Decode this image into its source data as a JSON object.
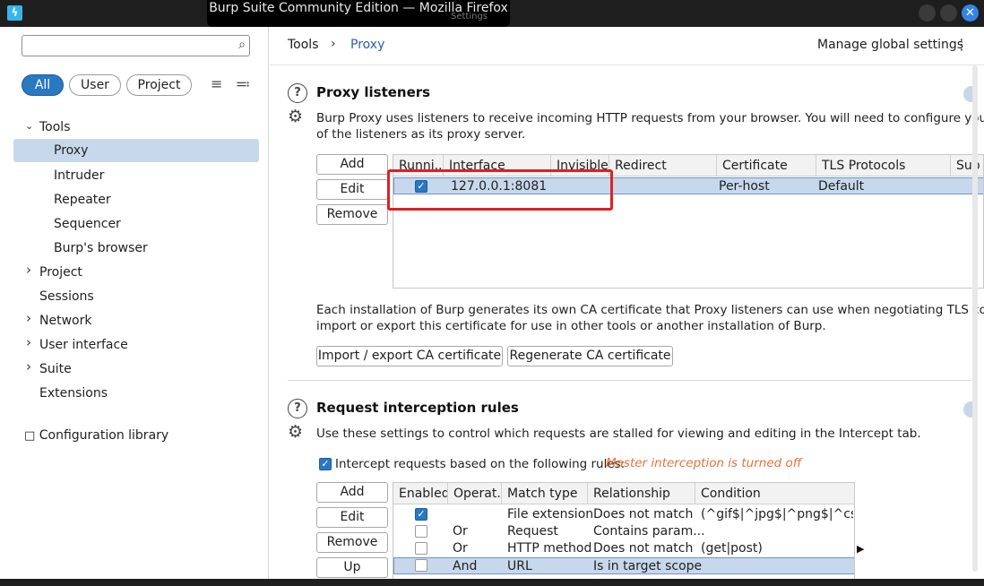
{
  "window": {
    "title": "Burp Suite Community Edition — Mozilla Firefox",
    "ghost_title": "Settings",
    "logo_glyph": "ϟ",
    "close_glyph": "✕"
  },
  "sidebar": {
    "search_placeholder": "",
    "search_icon_glyph": "⌕",
    "filters": [
      "All",
      "User",
      "Project"
    ],
    "expand_glyph": "≡",
    "collapse_glyph": "≕",
    "tree": [
      {
        "label": "Tools",
        "expanded": true
      },
      {
        "label": "Proxy",
        "selected": true
      },
      {
        "label": "Intruder"
      },
      {
        "label": "Repeater"
      },
      {
        "label": "Sequencer"
      },
      {
        "label": "Burp's browser"
      },
      {
        "label": "Project"
      },
      {
        "label": "Sessions"
      },
      {
        "label": "Network"
      },
      {
        "label": "User interface"
      },
      {
        "label": "Suite"
      },
      {
        "label": "Extensions"
      }
    ],
    "config_library": "Configuration library",
    "book_glyph": "🕮"
  },
  "header": {
    "breadcrumb": [
      "Tools",
      "Proxy"
    ],
    "separator": "›",
    "manage": "Manage global settings",
    "kebab": "⋮"
  },
  "proxy_listeners": {
    "title": "Proxy listeners",
    "description_line1": "Burp Proxy uses listeners to receive incoming HTTP requests from your browser. You will need to configure your brows",
    "description_line2": "of the listeners as its proxy server.",
    "buttons": [
      "Add",
      "Edit",
      "Remove"
    ],
    "columns": [
      "Runni...",
      "Interface",
      "Invisible",
      "Redirect",
      "Certificate",
      "TLS Protocols",
      "Sup"
    ],
    "rows": [
      {
        "running": true,
        "interface": "127.0.0.1:8081",
        "invisible": "",
        "redirect": "",
        "certificate": "Per-host",
        "tls": "Default"
      }
    ],
    "ca_line1": "Each installation of Burp generates its own CA certificate that Proxy listeners can use when negotiating TLS connection",
    "ca_line2": "import or export this certificate for use in other tools or another installation of Burp.",
    "import_btn": "Import / export CA certificate",
    "regen_btn": "Regenerate CA certificate"
  },
  "interception": {
    "title": "Request interception rules",
    "description": "Use these settings to control which requests are stalled for viewing and editing in the Intercept tab.",
    "checkbox_label": "Intercept requests based on the following rules:",
    "warning": "Master interception is turned off",
    "buttons": [
      "Add",
      "Edit",
      "Remove",
      "Up"
    ],
    "columns": [
      "Enabled",
      "Operat...",
      "Match type",
      "Relationship",
      "Condition"
    ],
    "rows": [
      {
        "enabled": true,
        "operator": "",
        "match": "File extension",
        "relationship": "Does not match",
        "condition": "(^gif$|^jpg$|^png$|^css..."
      },
      {
        "enabled": false,
        "operator": "Or",
        "match": "Request",
        "relationship": "Contains param...",
        "condition": ""
      },
      {
        "enabled": false,
        "operator": "Or",
        "match": "HTTP method",
        "relationship": "Does not match",
        "condition": "(get|post)"
      },
      {
        "enabled": false,
        "operator": "And",
        "match": "URL",
        "relationship": "Is in target scope",
        "condition": ""
      }
    ]
  },
  "icons": {
    "help": "?",
    "gear": "⚙",
    "check": "✓",
    "right_arrow": "▶",
    "chev_down": "⌄",
    "chev_right": "›"
  },
  "colors": {
    "accent": "#2a78c2",
    "selection": "#c8d8ec",
    "warning": "#e8703a",
    "highlight": "#e02020"
  }
}
